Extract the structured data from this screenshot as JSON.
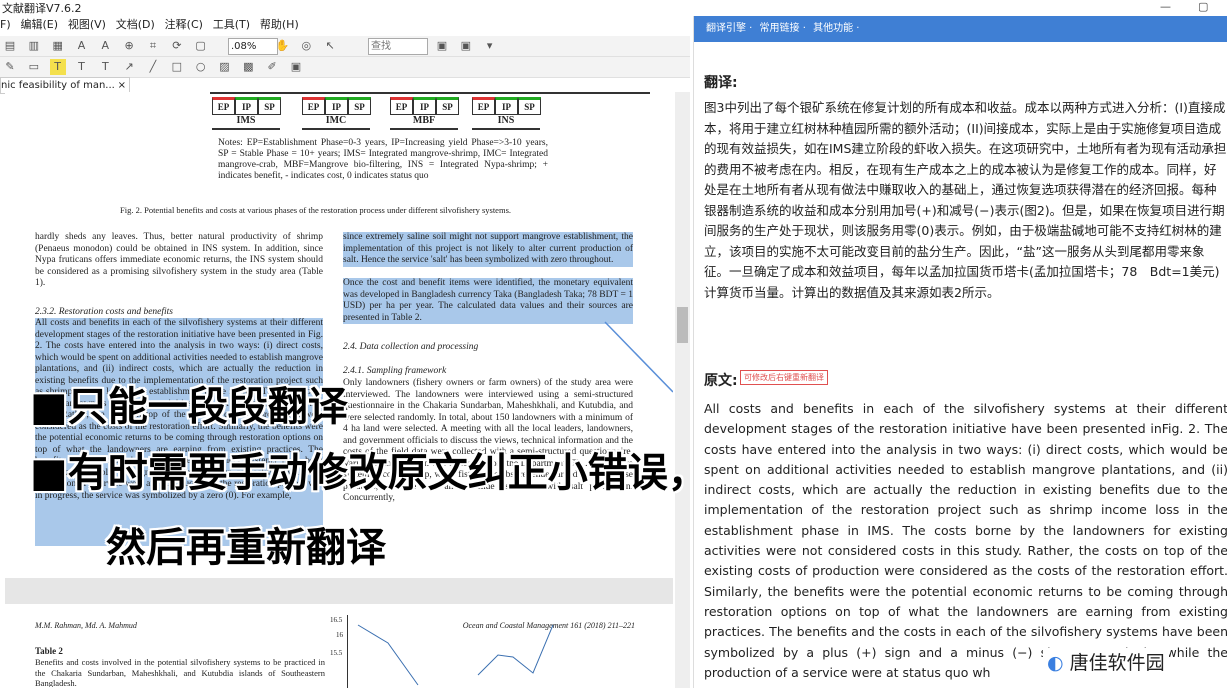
{
  "app": {
    "title": "文献翻译V7.6.2",
    "min": "—",
    "max": "▢"
  },
  "menu": [
    "编辑(E)",
    "视图(V)",
    "文档(D)",
    "注释(C)",
    "工具(T)",
    "帮助(H)"
  ],
  "menu_prefix": "F)",
  "toolbar": {
    "zoom": ".08%",
    "find_placeholder": "查找"
  },
  "doc_tab": {
    "label": "nic feasibility of man...",
    "close": "×"
  },
  "pdf": {
    "phases": [
      "EP",
      "IP",
      "SP",
      "EP",
      "IP",
      "SP",
      "EP",
      "IP",
      "SP",
      "EP",
      "IP",
      "SP"
    ],
    "groups": [
      "IMS",
      "IMC",
      "MBF",
      "INS"
    ],
    "notes": "Notes: EP=Establishment Phase=0-3 years, IP=Increasing yield Phase=>3-10 years, SP = Stable Phase = 10+ years; IMS= Integrated mangrove-shrimp, IMC= Integrated mangrove-crab, MBF=Mangrove bio-filtering, INS = Integrated Nypa-shrimp; + indicates benefit, - indicates cost, 0 indicates status quo",
    "fig_caption": "Fig. 2. Potential benefits and costs at various phases of the restoration process under different silvofishery systems.",
    "left_col1": "hardly sheds any leaves. Thus, better natural productivity of shrimp (Penaeus monodon) could be obtained in INS system. In addition, since Nypa fruticans offers immediate economic returns, the INS system should be considered as a promising silvofishery system in the study area (Table 1).",
    "heading_232": "2.3.2. Restoration costs and benefits",
    "left_col2": "All costs and benefits in each of the silvofishery systems at their different development stages of the restoration initiative have been presented in Fig. 2. The costs have entered into the analysis in two ways: (i) direct costs, which would be spent on additional activities needed to establish mangrove plantations, and (ii) indirect costs, which are actually the reduction in existing benefits due to the implementation of the restoration project such as shrimp income loss in the establishment phase in IMS. The costs borne by the landowners for existing activities were not considered costs in this study. Rather, the costs on top of the existing costs of production were considered as the costs of the restoration effort. Similarly, the benefits were the potential economic returns to be coming through restoration options on top of what the landowners are earning from existing practices. The benefits and the costs in each of the silvofishery systems have been symbolized by a plus (+) sign and a minus (−) sign, respectively, while the production of a service were at status quo while the restoration process was in progress, the service was symbolized by a zero (0). For example,",
    "right_col1": "since extremely saline soil might not support mangrove establishment, the implementation of this project is not likely to alter current production of salt. Hence the service 'salt' has been symbolized with zero throughout.",
    "right_col2": "Once the cost and benefit items were identified, the monetary equivalent was developed in Bangladesh currency Taka (Bangladesh Taka; 78 BDT = 1 USD) per ha per year. The calculated data values and their sources are presented in Table 2.",
    "heading_24": "2.4. Data collection and processing",
    "heading_241": "2.4.1. Sampling framework",
    "right_col3": "Only landowners (fishery owners or farm owners) of the study area were interviewed. The landowners were interviewed using a semi-structured questionnaire in the Chakaria Sundarban, Maheshkhali, and Kutubdia, and were selected randomly. In total, about 150 landowners with a minimum of 4 ha land were selected. A meeting with all the local leaders, landowners, and government officials to discuss the views, technical information and the costs of the field data were collected with a semi-structured questionnaire. Variables: Information was collected from the Department (T) ... productive system of cost, shrimp, white fish, and crabs; revenue earned from all these products, and the cost and revenue associated with salt production. Concurrently,",
    "footer_left": "M.M. Rahman, Md. A. Mahmud",
    "footer_right": "Ocean and Coastal Management 161 (2018) 211–221",
    "table_title": "Table 2",
    "table_caption": "Benefits and costs involved in the potential silvofishery systems to be practiced in the Chakaria Sundarban, Maheshkhali, and Kutubdia islands of Southeastern Bangladesh.",
    "mini_ticks": [
      "16.5",
      "16",
      "15.5"
    ]
  },
  "overlay": {
    "line1": "■只能一段段翻译",
    "line2": "■有时需要手动修改原文纠正小错误，",
    "line3": "然后再重新翻译"
  },
  "right_panel": {
    "header": [
      "翻译引擎 ·",
      "常用链接 ·",
      "其他功能 ·"
    ],
    "translation_heading": "翻译:",
    "translation_text": "图3中列出了每个银矿系统在修复计划的所有成本和收益。成本以两种方式进入分析：(I)直接成本，将用于建立红树林种植园所需的额外活动；(II)间接成本，实际上是由于实施修复项目造成的现有效益损失，如在IMS建立阶段的虾收入损失。在这项研究中，土地所有者为现有活动承担的费用不被考虑在内。相反，在现有生产成本之上的成本被认为是修复工作的成本。同样，好处是在土地所有者从现有做法中赚取收入的基础上，通过恢复选项获得潜在的经济回报。每种银器制造系统的收益和成本分别用加号(+)和减号(−)表示(图2)。但是，如果在恢复项目进行期间服务的生产处于现状，则该服务用零(0)表示。例如，由于极端盐碱地可能不支持红树林的建立，该项目的实施不太可能改变目前的盐分生产。因此，“盐”这一服务从头到尾都用零来象征。一旦确定了成本和效益项目，每年以孟加拉国货币塔卡(孟加拉国塔卡；78　Bdt=1美元)计算货币当量。计算出的数据值及其来源如表2所示。",
    "original_heading": "原文:",
    "original_hint": "可修改后右键重新翻译",
    "original_text": "All costs and benefits in each of the silvofishery systems at their different development stages of the restoration initiative have been presented inFig. 2. The costs have entered into the analysis in two ways: (i) direct costs, which would be spent on additional activities needed to establish mangrove plantations, and (ii) indirect costs, which are actually the reduction in existing benefits due to the implementation of the restoration project such as shrimp income loss in the establishment phase in IMS. The costs borne by the landowners for existing activities were not considered costs in this study. Rather, the costs on top of the existing costs of production were considered as the costs of the restoration effort. Similarly, the benefits were the potential economic returns to be coming through restoration options on top of what the landowners are earning from existing practices. The benefits and the costs in each of the silvofishery systems have been symbolized by a plus (+) sign and a minus (−) sign, respectively, while the production of a service were at status quo wh"
  },
  "watermark": "唐佳软件园"
}
